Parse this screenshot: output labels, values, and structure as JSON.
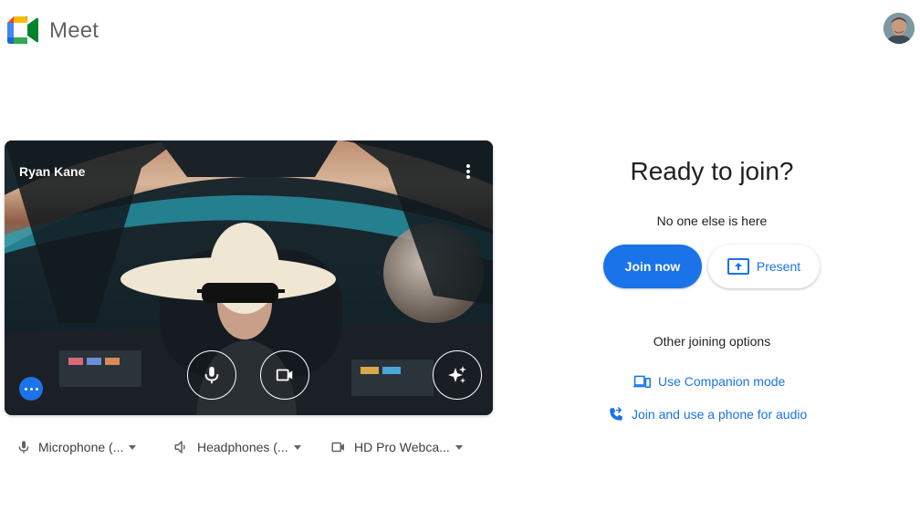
{
  "header": {
    "brand": "Meet"
  },
  "preview": {
    "participant_name": "Ryan Kane"
  },
  "devices": {
    "microphone": "Microphone (...",
    "speaker": "Headphones (...",
    "camera": "HD Pro Webca..."
  },
  "panel": {
    "title": "Ready to join?",
    "status": "No one else is here",
    "join_label": "Join now",
    "present_label": "Present",
    "other_options": "Other joining options",
    "companion_label": "Use Companion mode",
    "phone_label": "Join and use a phone for audio"
  },
  "colors": {
    "primary": "#1a73e8",
    "text": "#202124",
    "secondary_text": "#5f6368"
  },
  "icons": {
    "logo": "google-meet-logo",
    "more": "more-vert-icon",
    "mic": "microphone-icon",
    "camera": "videocam-icon",
    "effects": "sparkle-icon",
    "overflow": "more-horiz-icon",
    "speaker": "speaker-icon",
    "present": "present-to-all-icon",
    "companion": "devices-icon",
    "phone": "phone-forwarded-icon"
  }
}
